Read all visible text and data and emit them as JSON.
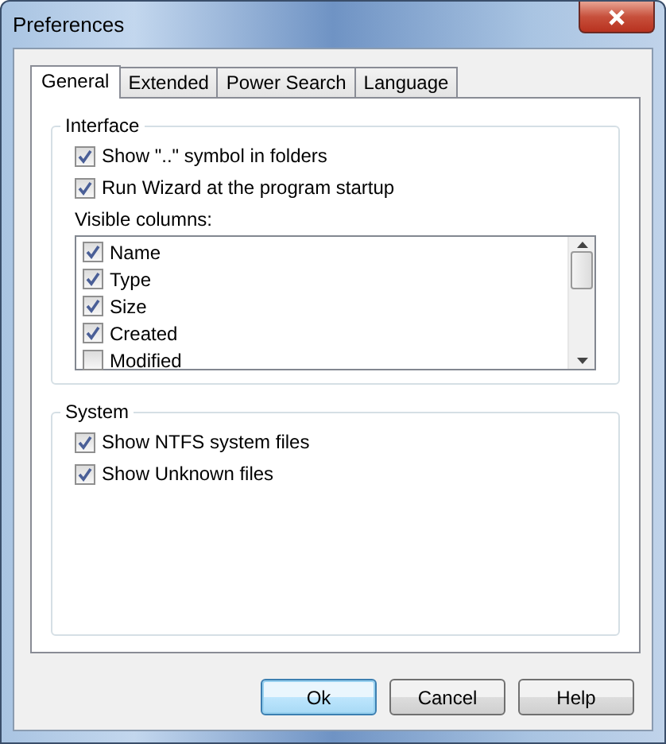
{
  "window": {
    "title": "Preferences"
  },
  "tabs": [
    {
      "label": "General",
      "selected": true
    },
    {
      "label": "Extended",
      "selected": false
    },
    {
      "label": "Power Search",
      "selected": false
    },
    {
      "label": "Language",
      "selected": false
    }
  ],
  "interface": {
    "title": "Interface",
    "options": [
      {
        "label": "Show \"..\" symbol in folders",
        "checked": true
      },
      {
        "label": "Run Wizard at the program startup",
        "checked": true
      }
    ],
    "columns_label": "Visible columns:",
    "columns": [
      {
        "label": "Name",
        "checked": true
      },
      {
        "label": "Type",
        "checked": true
      },
      {
        "label": "Size",
        "checked": true
      },
      {
        "label": "Created",
        "checked": true
      },
      {
        "label": "Modified",
        "checked": false
      }
    ]
  },
  "system": {
    "title": "System",
    "options": [
      {
        "label": "Show NTFS system files",
        "checked": true
      },
      {
        "label": "Show Unknown files",
        "checked": true
      }
    ]
  },
  "buttons": [
    {
      "label": "Ok",
      "default": true
    },
    {
      "label": "Cancel",
      "default": false
    },
    {
      "label": "Help",
      "default": false
    }
  ]
}
